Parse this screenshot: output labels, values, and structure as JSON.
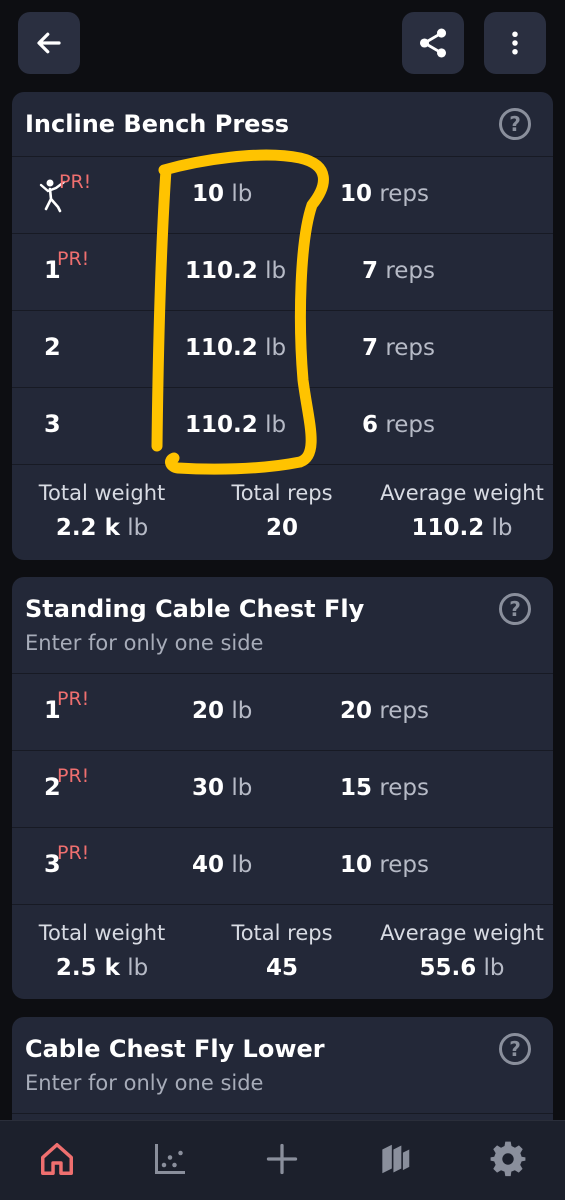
{
  "colors": {
    "accent": "#ef6f6f",
    "pr": "#ef6f6f",
    "card": "#232838",
    "background": "#0d0e12",
    "highlight": "#ffc300"
  },
  "header": {
    "back_icon": "arrow-left-icon",
    "share_icon": "share-icon",
    "menu_icon": "more-vertical-icon"
  },
  "exercises": [
    {
      "title": "Incline Bench Press",
      "subtitle": "",
      "sets": [
        {
          "label": "",
          "warmup_icon": "warmup-person-icon",
          "pr": "PR!",
          "weight": "10",
          "weight_unit": "lb",
          "reps": "10",
          "reps_unit": "reps"
        },
        {
          "label": "1",
          "pr": "PR!",
          "weight": "110.2",
          "weight_unit": "lb",
          "reps": "7",
          "reps_unit": "reps"
        },
        {
          "label": "2",
          "pr": "",
          "weight": "110.2",
          "weight_unit": "lb",
          "reps": "7",
          "reps_unit": "reps"
        },
        {
          "label": "3",
          "pr": "",
          "weight": "110.2",
          "weight_unit": "lb",
          "reps": "6",
          "reps_unit": "reps"
        }
      ],
      "totals": {
        "total_weight_label": "Total weight",
        "total_weight": "2.2 k",
        "total_weight_unit": "lb",
        "total_reps_label": "Total reps",
        "total_reps": "20",
        "avg_weight_label": "Average weight",
        "avg_weight": "110.2",
        "avg_weight_unit": "lb"
      }
    },
    {
      "title": "Standing Cable Chest Fly",
      "subtitle": "Enter for only one side",
      "sets": [
        {
          "label": "1",
          "pr": "PR!",
          "weight": "20",
          "weight_unit": "lb",
          "reps": "20",
          "reps_unit": "reps"
        },
        {
          "label": "2",
          "pr": "PR!",
          "weight": "30",
          "weight_unit": "lb",
          "reps": "15",
          "reps_unit": "reps"
        },
        {
          "label": "3",
          "pr": "PR!",
          "weight": "40",
          "weight_unit": "lb",
          "reps": "10",
          "reps_unit": "reps"
        }
      ],
      "totals": {
        "total_weight_label": "Total weight",
        "total_weight": "2.5 k",
        "total_weight_unit": "lb",
        "total_reps_label": "Total reps",
        "total_reps": "45",
        "avg_weight_label": "Average weight",
        "avg_weight": "55.6",
        "avg_weight_unit": "lb"
      }
    },
    {
      "title": "Cable Chest Fly Lower",
      "subtitle": "Enter for only one side"
    }
  ],
  "help_symbol": "?",
  "bottom_nav": [
    {
      "icon": "home-icon",
      "active": true
    },
    {
      "icon": "chart-icon",
      "active": false
    },
    {
      "icon": "add-icon",
      "active": false
    },
    {
      "icon": "plates-icon",
      "active": false
    },
    {
      "icon": "settings-icon",
      "active": false
    }
  ]
}
